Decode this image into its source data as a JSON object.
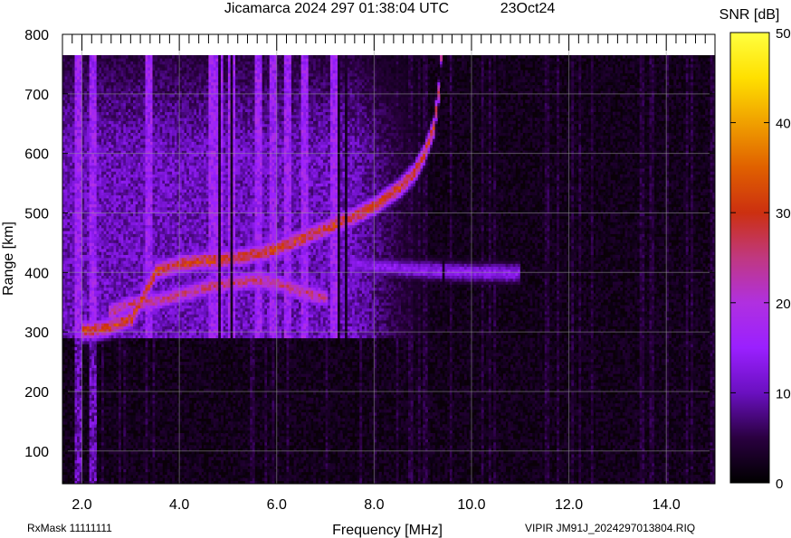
{
  "header": {
    "title": "Jicamarca 2024 297 01:38:04 UTC",
    "date": "23Oct24"
  },
  "footer": {
    "left": "RxMask 11111111",
    "right": "VIPIR  JM91J_2024297013804.RIQ"
  },
  "chart_data": {
    "type": "heatmap",
    "title": "Jicamarca 2024 297 01:38:04 UTC",
    "xlabel": "Frequency [MHz]",
    "ylabel": "Range [km]",
    "xlim": [
      1.6,
      15.0
    ],
    "ylim": [
      45,
      800
    ],
    "x_ticks": [
      "2.0",
      "4.0",
      "6.0",
      "8.0",
      "10.0",
      "12.0",
      "14.0"
    ],
    "x_tick_values": [
      2,
      4,
      6,
      8,
      10,
      12,
      14
    ],
    "y_ticks": [
      "100",
      "200",
      "300",
      "400",
      "500",
      "600",
      "700",
      "800"
    ],
    "y_tick_values": [
      100,
      200,
      300,
      400,
      500,
      600,
      700,
      800
    ],
    "data_top_km": 765,
    "grid": true,
    "colorbar": {
      "label": "SNR [dB]",
      "range": [
        0,
        50
      ],
      "ticks": [
        "0",
        "10",
        "20",
        "30",
        "40",
        "50"
      ],
      "tick_values": [
        0,
        10,
        20,
        30,
        40,
        50
      ],
      "colors": [
        "#000000",
        "#2a0040",
        "#6a10c0",
        "#9a20ff",
        "#b030e0",
        "#c03880",
        "#cc3010",
        "#e06000",
        "#f0a000",
        "#ffe000",
        "#ffff40"
      ]
    },
    "traces": [
      {
        "label": "F-layer O-mode echo",
        "snr_db": 30,
        "points": [
          [
            2.0,
            300
          ],
          [
            2.5,
            305
          ],
          [
            3.0,
            320
          ],
          [
            3.5,
            400
          ],
          [
            4.0,
            412
          ],
          [
            4.5,
            418
          ],
          [
            5.0,
            420
          ],
          [
            5.5,
            428
          ],
          [
            6.0,
            438
          ],
          [
            6.5,
            455
          ],
          [
            7.0,
            472
          ],
          [
            7.5,
            490
          ],
          [
            8.0,
            510
          ],
          [
            8.5,
            540
          ],
          [
            8.8,
            565
          ],
          [
            9.0,
            595
          ],
          [
            9.2,
            640
          ],
          [
            9.3,
            700
          ],
          [
            9.35,
            765
          ]
        ]
      },
      {
        "label": "Lower echo branch",
        "snr_db": 25,
        "points": [
          [
            2.5,
            330
          ],
          [
            3.0,
            345
          ],
          [
            3.5,
            350
          ],
          [
            4.0,
            360
          ],
          [
            4.5,
            372
          ],
          [
            5.0,
            380
          ],
          [
            5.5,
            385
          ],
          [
            6.0,
            380
          ],
          [
            6.5,
            365
          ],
          [
            7.0,
            355
          ]
        ]
      },
      {
        "label": "Weak 400 km echo",
        "snr_db": 14,
        "points": [
          [
            7.5,
            412
          ],
          [
            8.0,
            408
          ],
          [
            8.5,
            405
          ],
          [
            9.0,
            402
          ],
          [
            9.5,
            400
          ],
          [
            10.0,
            398
          ],
          [
            10.5,
            397
          ],
          [
            11.0,
            397
          ]
        ]
      }
    ],
    "diffuse_region": {
      "x": [
        1.6,
        9.4
      ],
      "range_km": [
        290,
        765
      ],
      "snr_db": 12
    },
    "bright_vertical_bands_mhz": [
      1.9,
      2.2,
      3.35,
      4.65,
      4.8,
      5.05,
      5.6,
      5.9,
      6.2,
      6.55,
      7.15
    ],
    "dark_vertical_bands_mhz": [
      4.8,
      5.05,
      7.25,
      7.4,
      9.4
    ]
  }
}
